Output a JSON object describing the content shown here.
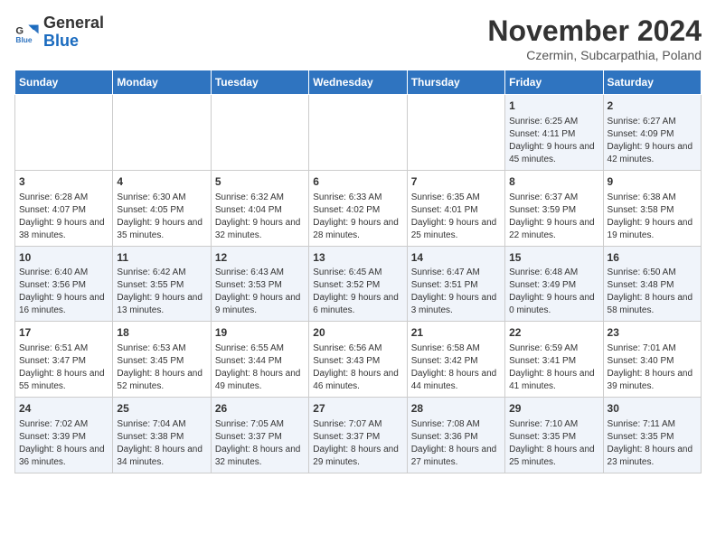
{
  "logo": {
    "general": "General",
    "blue": "Blue"
  },
  "title": "November 2024",
  "subtitle": "Czermin, Subcarpathia, Poland",
  "days_of_week": [
    "Sunday",
    "Monday",
    "Tuesday",
    "Wednesday",
    "Thursday",
    "Friday",
    "Saturday"
  ],
  "weeks": [
    [
      {
        "day": "",
        "info": ""
      },
      {
        "day": "",
        "info": ""
      },
      {
        "day": "",
        "info": ""
      },
      {
        "day": "",
        "info": ""
      },
      {
        "day": "",
        "info": ""
      },
      {
        "day": "1",
        "info": "Sunrise: 6:25 AM\nSunset: 4:11 PM\nDaylight: 9 hours and 45 minutes."
      },
      {
        "day": "2",
        "info": "Sunrise: 6:27 AM\nSunset: 4:09 PM\nDaylight: 9 hours and 42 minutes."
      }
    ],
    [
      {
        "day": "3",
        "info": "Sunrise: 6:28 AM\nSunset: 4:07 PM\nDaylight: 9 hours and 38 minutes."
      },
      {
        "day": "4",
        "info": "Sunrise: 6:30 AM\nSunset: 4:05 PM\nDaylight: 9 hours and 35 minutes."
      },
      {
        "day": "5",
        "info": "Sunrise: 6:32 AM\nSunset: 4:04 PM\nDaylight: 9 hours and 32 minutes."
      },
      {
        "day": "6",
        "info": "Sunrise: 6:33 AM\nSunset: 4:02 PM\nDaylight: 9 hours and 28 minutes."
      },
      {
        "day": "7",
        "info": "Sunrise: 6:35 AM\nSunset: 4:01 PM\nDaylight: 9 hours and 25 minutes."
      },
      {
        "day": "8",
        "info": "Sunrise: 6:37 AM\nSunset: 3:59 PM\nDaylight: 9 hours and 22 minutes."
      },
      {
        "day": "9",
        "info": "Sunrise: 6:38 AM\nSunset: 3:58 PM\nDaylight: 9 hours and 19 minutes."
      }
    ],
    [
      {
        "day": "10",
        "info": "Sunrise: 6:40 AM\nSunset: 3:56 PM\nDaylight: 9 hours and 16 minutes."
      },
      {
        "day": "11",
        "info": "Sunrise: 6:42 AM\nSunset: 3:55 PM\nDaylight: 9 hours and 13 minutes."
      },
      {
        "day": "12",
        "info": "Sunrise: 6:43 AM\nSunset: 3:53 PM\nDaylight: 9 hours and 9 minutes."
      },
      {
        "day": "13",
        "info": "Sunrise: 6:45 AM\nSunset: 3:52 PM\nDaylight: 9 hours and 6 minutes."
      },
      {
        "day": "14",
        "info": "Sunrise: 6:47 AM\nSunset: 3:51 PM\nDaylight: 9 hours and 3 minutes."
      },
      {
        "day": "15",
        "info": "Sunrise: 6:48 AM\nSunset: 3:49 PM\nDaylight: 9 hours and 0 minutes."
      },
      {
        "day": "16",
        "info": "Sunrise: 6:50 AM\nSunset: 3:48 PM\nDaylight: 8 hours and 58 minutes."
      }
    ],
    [
      {
        "day": "17",
        "info": "Sunrise: 6:51 AM\nSunset: 3:47 PM\nDaylight: 8 hours and 55 minutes."
      },
      {
        "day": "18",
        "info": "Sunrise: 6:53 AM\nSunset: 3:45 PM\nDaylight: 8 hours and 52 minutes."
      },
      {
        "day": "19",
        "info": "Sunrise: 6:55 AM\nSunset: 3:44 PM\nDaylight: 8 hours and 49 minutes."
      },
      {
        "day": "20",
        "info": "Sunrise: 6:56 AM\nSunset: 3:43 PM\nDaylight: 8 hours and 46 minutes."
      },
      {
        "day": "21",
        "info": "Sunrise: 6:58 AM\nSunset: 3:42 PM\nDaylight: 8 hours and 44 minutes."
      },
      {
        "day": "22",
        "info": "Sunrise: 6:59 AM\nSunset: 3:41 PM\nDaylight: 8 hours and 41 minutes."
      },
      {
        "day": "23",
        "info": "Sunrise: 7:01 AM\nSunset: 3:40 PM\nDaylight: 8 hours and 39 minutes."
      }
    ],
    [
      {
        "day": "24",
        "info": "Sunrise: 7:02 AM\nSunset: 3:39 PM\nDaylight: 8 hours and 36 minutes."
      },
      {
        "day": "25",
        "info": "Sunrise: 7:04 AM\nSunset: 3:38 PM\nDaylight: 8 hours and 34 minutes."
      },
      {
        "day": "26",
        "info": "Sunrise: 7:05 AM\nSunset: 3:37 PM\nDaylight: 8 hours and 32 minutes."
      },
      {
        "day": "27",
        "info": "Sunrise: 7:07 AM\nSunset: 3:37 PM\nDaylight: 8 hours and 29 minutes."
      },
      {
        "day": "28",
        "info": "Sunrise: 7:08 AM\nSunset: 3:36 PM\nDaylight: 8 hours and 27 minutes."
      },
      {
        "day": "29",
        "info": "Sunrise: 7:10 AM\nSunset: 3:35 PM\nDaylight: 8 hours and 25 minutes."
      },
      {
        "day": "30",
        "info": "Sunrise: 7:11 AM\nSunset: 3:35 PM\nDaylight: 8 hours and 23 minutes."
      }
    ]
  ]
}
